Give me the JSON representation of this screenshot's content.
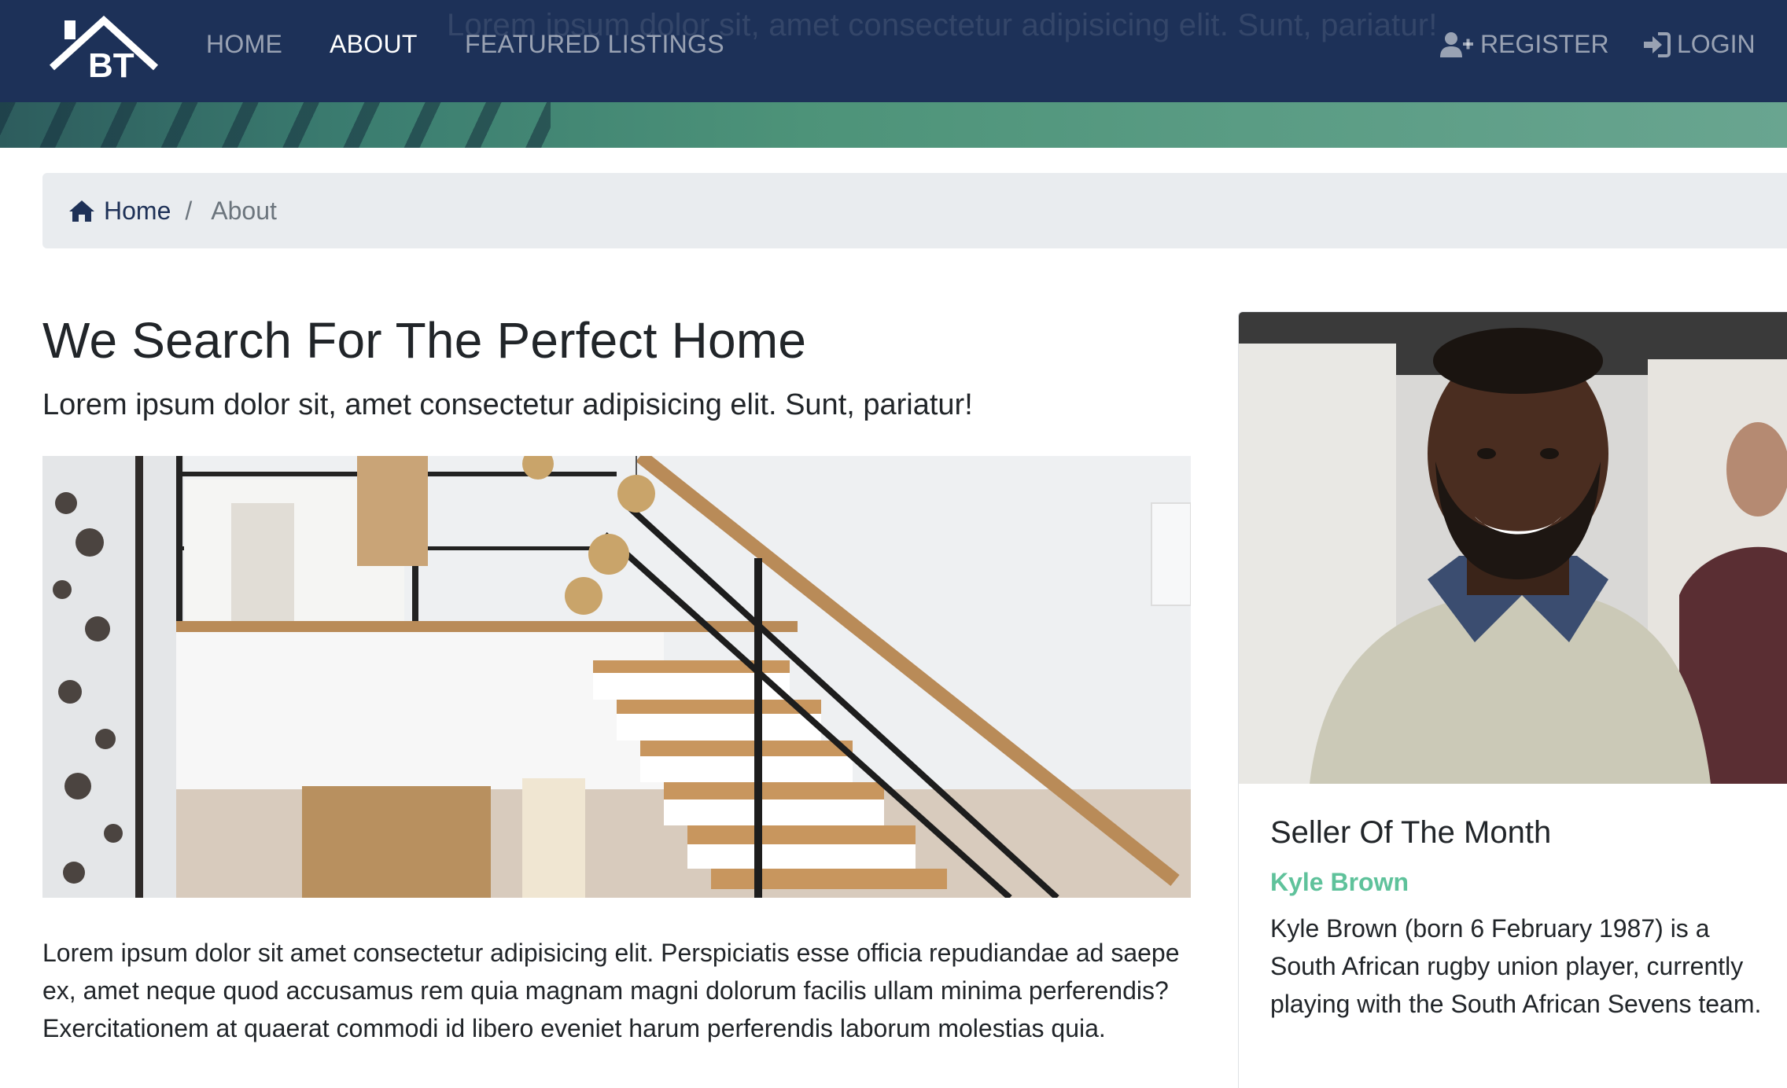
{
  "navbar": {
    "brand": "BT",
    "links": [
      {
        "label": "HOME",
        "active": false
      },
      {
        "label": "ABOUT",
        "active": true
      },
      {
        "label": "FEATURED LISTINGS",
        "active": false
      }
    ],
    "ghost_text": "Lorem ipsum dolor sit, amet consectetur adipisicing elit. Sunt, pariatur!",
    "register": {
      "label": "REGISTER",
      "icon": "user-plus-icon"
    },
    "login": {
      "label": "LOGIN",
      "icon": "sign-in-icon"
    },
    "colors": {
      "background": "#1d3158",
      "band": "#4d9379"
    }
  },
  "breadcrumb": {
    "home": {
      "label": "Home",
      "icon": "home-icon"
    },
    "separator": "/",
    "current": "About"
  },
  "main": {
    "title": "We Search For The Perfect Home",
    "lead": "Lorem ipsum dolor sit, amet consectetur adipisicing elit. Sunt, pariatur!",
    "body": "Lorem ipsum dolor sit amet consectetur adipisicing elit. Perspiciatis esse officia repudiandae ad saepe ex, amet neque quod accusamus rem quia magnam magni dolorum facilis ullam minima perferendis? Exercitationem at quaerat commodi id libero eveniet harum perferendis laborum molestias quia."
  },
  "seller": {
    "title": "Seller Of The Month",
    "name": "Kyle Brown",
    "bio": "Kyle Brown (born 6 February 1987) is a South African rugby union player, currently playing with the South African Sevens team.",
    "name_color": "#5fc29b"
  }
}
